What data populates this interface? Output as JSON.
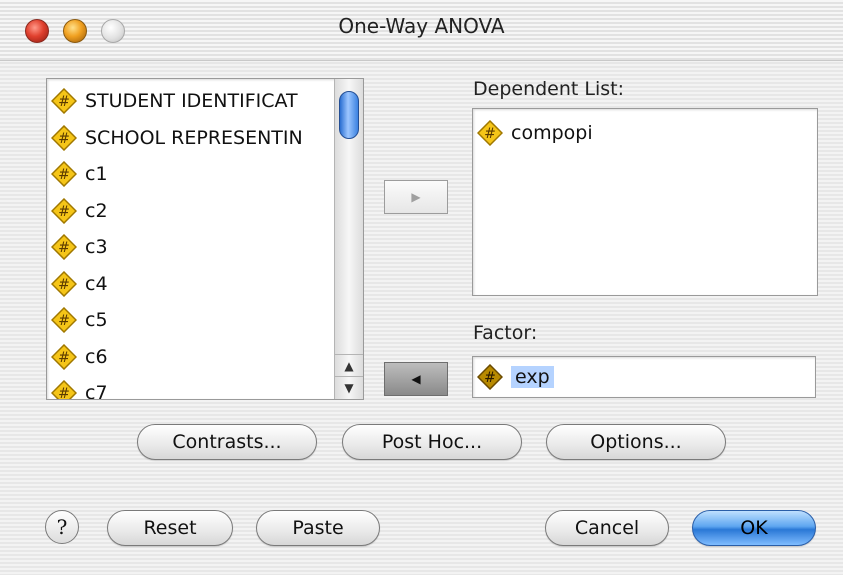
{
  "window": {
    "title": "One-Way ANOVA"
  },
  "source_list": {
    "items": [
      "STUDENT IDENTIFICAT",
      "SCHOOL REPRESENTIN",
      "c1",
      "c2",
      "c3",
      "c4",
      "c5",
      "c6",
      "c7"
    ]
  },
  "dependent": {
    "label": "Dependent List:",
    "items": [
      "compopi"
    ]
  },
  "factor": {
    "label": "Factor:",
    "value": "exp"
  },
  "buttons": {
    "contrasts": "Contrasts...",
    "post_hoc": "Post Hoc...",
    "options": "Options...",
    "help": "?",
    "reset": "Reset",
    "paste": "Paste",
    "cancel": "Cancel",
    "ok": "OK"
  },
  "icons": {
    "numeric_variable": "numeric-variable-icon"
  },
  "colors": {
    "ok_button": "#3a86e0",
    "selection": "#b5d3ff",
    "icon_fill": "#f5c518"
  }
}
